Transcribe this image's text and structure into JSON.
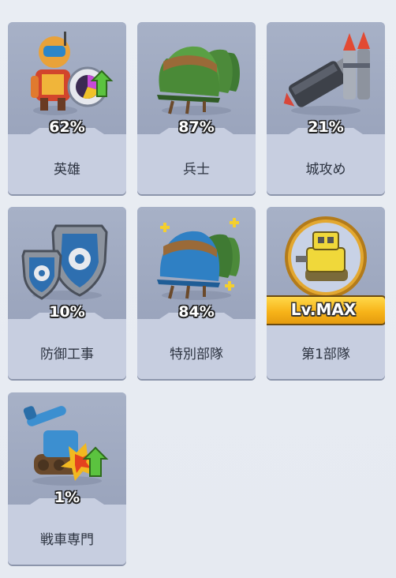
{
  "categories": [
    {
      "id": "hero",
      "label": "英雄",
      "progress_text": "62%",
      "icon": "hero-icon"
    },
    {
      "id": "soldier",
      "label": "兵士",
      "progress_text": "87%",
      "icon": "helmets-icon"
    },
    {
      "id": "siege",
      "label": "城攻め",
      "progress_text": "21%",
      "icon": "rockets-icon"
    },
    {
      "id": "defense",
      "label": "防御工事",
      "progress_text": "10%",
      "icon": "shields-icon"
    },
    {
      "id": "special",
      "label": "特別部隊",
      "progress_text": "84%",
      "icon": "special-helmets-icon"
    },
    {
      "id": "first_unit",
      "label": "第1部隊",
      "badge": "Lv.MAX",
      "icon": "robot-tank-icon"
    },
    {
      "id": "tank",
      "label": "戦車専門",
      "progress_text": "1%",
      "icon": "tank-upgrade-icon"
    }
  ]
}
